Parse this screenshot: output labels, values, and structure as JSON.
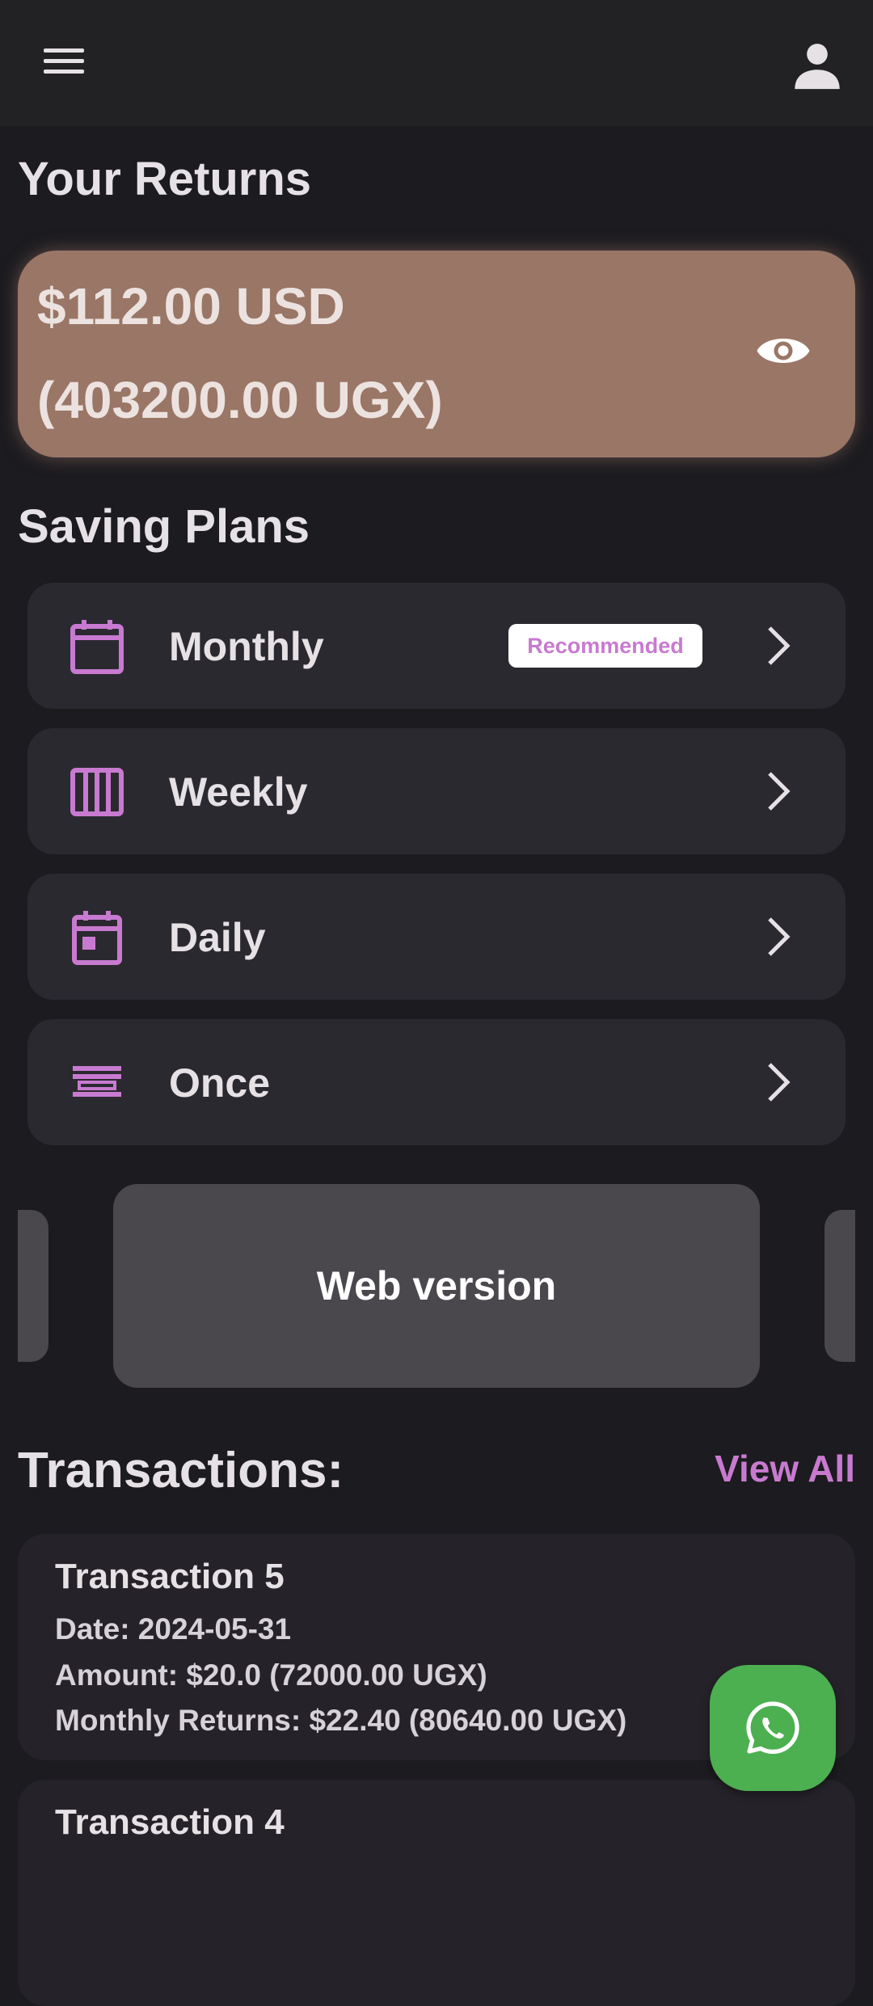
{
  "header": {
    "menu_icon": "menu-icon",
    "account_icon": "account-icon"
  },
  "returns": {
    "title": "Your Returns",
    "usd": "$112.00 USD",
    "ugx": "(403200.00 UGX)",
    "card_color": "#9a7667",
    "visibility_icon": "eye-icon"
  },
  "plans": {
    "title": "Saving Plans",
    "items": [
      {
        "label": "Monthly",
        "icon": "calendar-month-icon",
        "badge": "Recommended"
      },
      {
        "label": "Weekly",
        "icon": "calendar-week-icon"
      },
      {
        "label": "Daily",
        "icon": "calendar-day-icon"
      },
      {
        "label": "Once",
        "icon": "list-icon"
      }
    ]
  },
  "carousel": {
    "label": "Web version"
  },
  "transactions": {
    "title": "Transactions:",
    "view_all": "View All",
    "items": [
      {
        "title": "Transaction 5",
        "date": "Date: 2024-05-31",
        "amount": "Amount: $20.0 (72000.00 UGX)",
        "returns": "Monthly Returns: $22.40 (80640.00 UGX)"
      },
      {
        "title": "Transaction 4"
      }
    ]
  },
  "fab": {
    "icon": "whatsapp-icon",
    "color": "#4caf50"
  },
  "colors": {
    "background": "#1c1b1f",
    "accent": "#c87ad0",
    "card": "#2b2930"
  }
}
